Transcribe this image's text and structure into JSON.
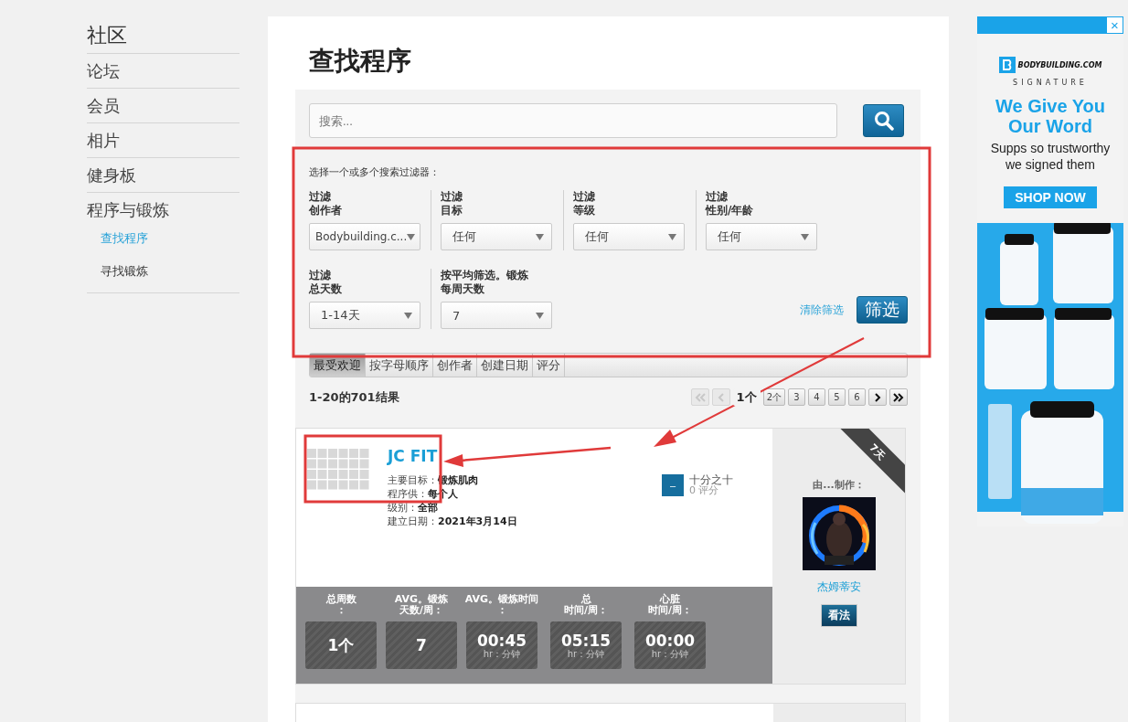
{
  "sidebar": {
    "title": "社区",
    "items": [
      {
        "label": "论坛",
        "selected": false
      },
      {
        "label": "会员",
        "selected": false
      },
      {
        "label": "相片",
        "selected": false
      },
      {
        "label": "健身板",
        "selected": false
      },
      {
        "label": "程序与锻炼",
        "selected": false,
        "children": [
          {
            "label": "查找程序",
            "selected": true
          },
          {
            "label": "寻找锻炼",
            "selected": false
          }
        ]
      }
    ]
  },
  "main": {
    "title": "查找程序",
    "search": {
      "placeholder": "搜索..."
    },
    "filters_intro": "选择一个或多个搜索过滤器：",
    "filters": [
      {
        "caption": "过滤",
        "label": "创作者",
        "value": "Bodybuilding.c..."
      },
      {
        "caption": "过滤",
        "label": "目标",
        "value": "任何"
      },
      {
        "caption": "过滤",
        "label": "等级",
        "value": "任何"
      },
      {
        "caption": "过滤",
        "label": "性别/年龄",
        "value": "任何"
      },
      {
        "caption": "过滤",
        "label": "总天数",
        "value": "1-14天"
      },
      {
        "caption": "按平均筛选。锻炼",
        "label": "每周天数",
        "value": "7"
      }
    ],
    "clear_link": "清除筛选",
    "filter_button": "筛选",
    "sort_tabs": [
      {
        "label": "最受欢迎",
        "selected": true
      },
      {
        "label": "按字母顺序",
        "selected": false
      },
      {
        "label": "创作者",
        "selected": false
      },
      {
        "label": "创建日期",
        "selected": false
      },
      {
        "label": "评分",
        "selected": false
      }
    ],
    "results_count": "1-20的701结果",
    "pagination": [
      {
        "kind": "first",
        "disabled": true
      },
      {
        "kind": "prev",
        "disabled": true
      },
      {
        "kind": "page",
        "label": "1个",
        "selected": true
      },
      {
        "kind": "page",
        "label": "2个",
        "selected": false
      },
      {
        "kind": "page",
        "label": "3",
        "selected": false
      },
      {
        "kind": "page",
        "label": "4",
        "selected": false
      },
      {
        "kind": "page",
        "label": "5",
        "selected": false
      },
      {
        "kind": "page",
        "label": "6",
        "selected": false
      },
      {
        "kind": "next",
        "disabled": false
      },
      {
        "kind": "last",
        "disabled": false
      }
    ],
    "program": {
      "title": "JC FIT",
      "ribbon": "7天",
      "details": [
        {
          "label": "主要目标：",
          "value": "锻炼肌肉"
        },
        {
          "label": "程序供：",
          "value": "每个人"
        },
        {
          "label": "级别：",
          "value": "全部"
        },
        {
          "label": "建立日期：",
          "value": "2021年3月14日"
        }
      ],
      "rating": {
        "button": "–",
        "score": "十分之十",
        "count": "0 评分"
      },
      "author": {
        "label": "由...制作：",
        "name": "杰姆蒂安",
        "button": "看法"
      },
      "stats": [
        {
          "label": [
            "总周数",
            "："
          ],
          "value": "1个"
        },
        {
          "label": [
            "AVG。锻炼",
            "天数/周："
          ],
          "value": "7"
        },
        {
          "label": [
            "AVG。锻炼时间",
            "："
          ],
          "value": "00:45",
          "unit": "hr：分钟"
        },
        {
          "label": [
            "总",
            "时间/周："
          ],
          "value": "05:15",
          "unit": "hr：分钟"
        },
        {
          "label": [
            "心脏",
            "时间/周："
          ],
          "value": "00:00",
          "unit": "hr：分钟"
        }
      ]
    }
  },
  "ad": {
    "close": "×",
    "brand": "BODYBUILDING.COM",
    "sub_brand": "SIGNATURE",
    "headline": "We Give You Our Word",
    "text": "Supps so trustworthy we signed them",
    "button": "SHOP NOW"
  }
}
